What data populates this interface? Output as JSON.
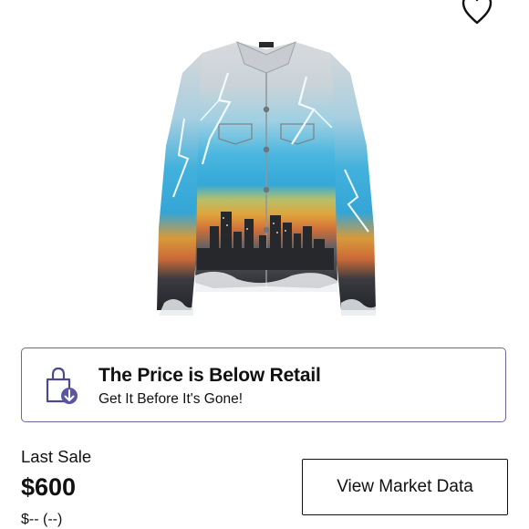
{
  "wishlist": {
    "icon": "heart-outline-icon"
  },
  "product": {
    "image": "denim-jacket-lightning-cityscape"
  },
  "banner": {
    "icon": "shopping-bag-price-down-icon",
    "title": "The Price is Below Retail",
    "subtitle": "Get It Before It's Gone!",
    "accent_color": "#5b56a0"
  },
  "last_sale": {
    "label": "Last Sale",
    "price": "$600",
    "change": "$-- (--)"
  },
  "market_button": {
    "label": "View Market Data"
  }
}
